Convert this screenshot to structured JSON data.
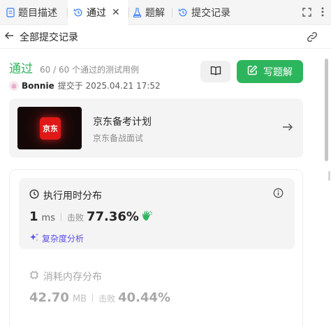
{
  "tabs": [
    {
      "label": "题目描述",
      "icon": "document-icon"
    },
    {
      "label": "通过",
      "icon": "history-icon",
      "active": true
    },
    {
      "label": "题解",
      "icon": "flask-icon"
    },
    {
      "label": "提交记录",
      "icon": "history-icon"
    }
  ],
  "header": {
    "back_title": "全部提交记录"
  },
  "submission": {
    "status": "通过",
    "testcases": "60 / 60 个通过的测试用例",
    "user": "Bonnie",
    "submitted_text": "提交于 2025.04.21 17:52",
    "write_solution_label": "写题解"
  },
  "promo": {
    "logo_text": "京东",
    "title": "京东备考计划",
    "subtitle": "京东备战面试"
  },
  "runtime": {
    "title": "执行用时分布",
    "value": "1",
    "unit": "ms",
    "beat_label": "击败",
    "beat_percent": "77.36%",
    "complexity_label": "复杂度分析"
  },
  "memory": {
    "title": "消耗内存分布",
    "value": "42.70",
    "unit": "MB",
    "beat_label": "击败",
    "beat_percent": "40.44%"
  },
  "colors": {
    "accent_green": "#2db55d",
    "complexity_purple": "#5b4ee8",
    "brand_red": "#e01818"
  }
}
